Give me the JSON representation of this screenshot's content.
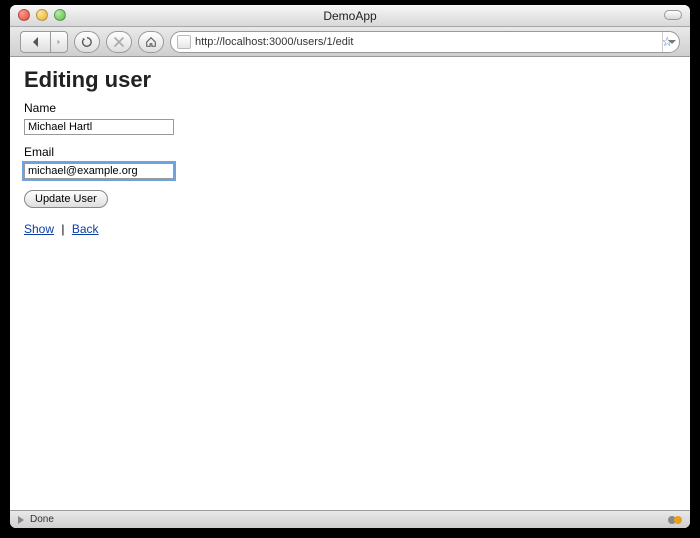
{
  "window": {
    "title": "DemoApp"
  },
  "toolbar": {
    "url": "http://localhost:3000/users/1/edit"
  },
  "page": {
    "heading": "Editing user",
    "name_label": "Name",
    "name_value": "Michael Hartl",
    "email_label": "Email",
    "email_value": "michael@example.org",
    "submit_label": "Update User",
    "show_link": "Show",
    "separator": "|",
    "back_link": "Back"
  },
  "status": {
    "text": "Done"
  }
}
